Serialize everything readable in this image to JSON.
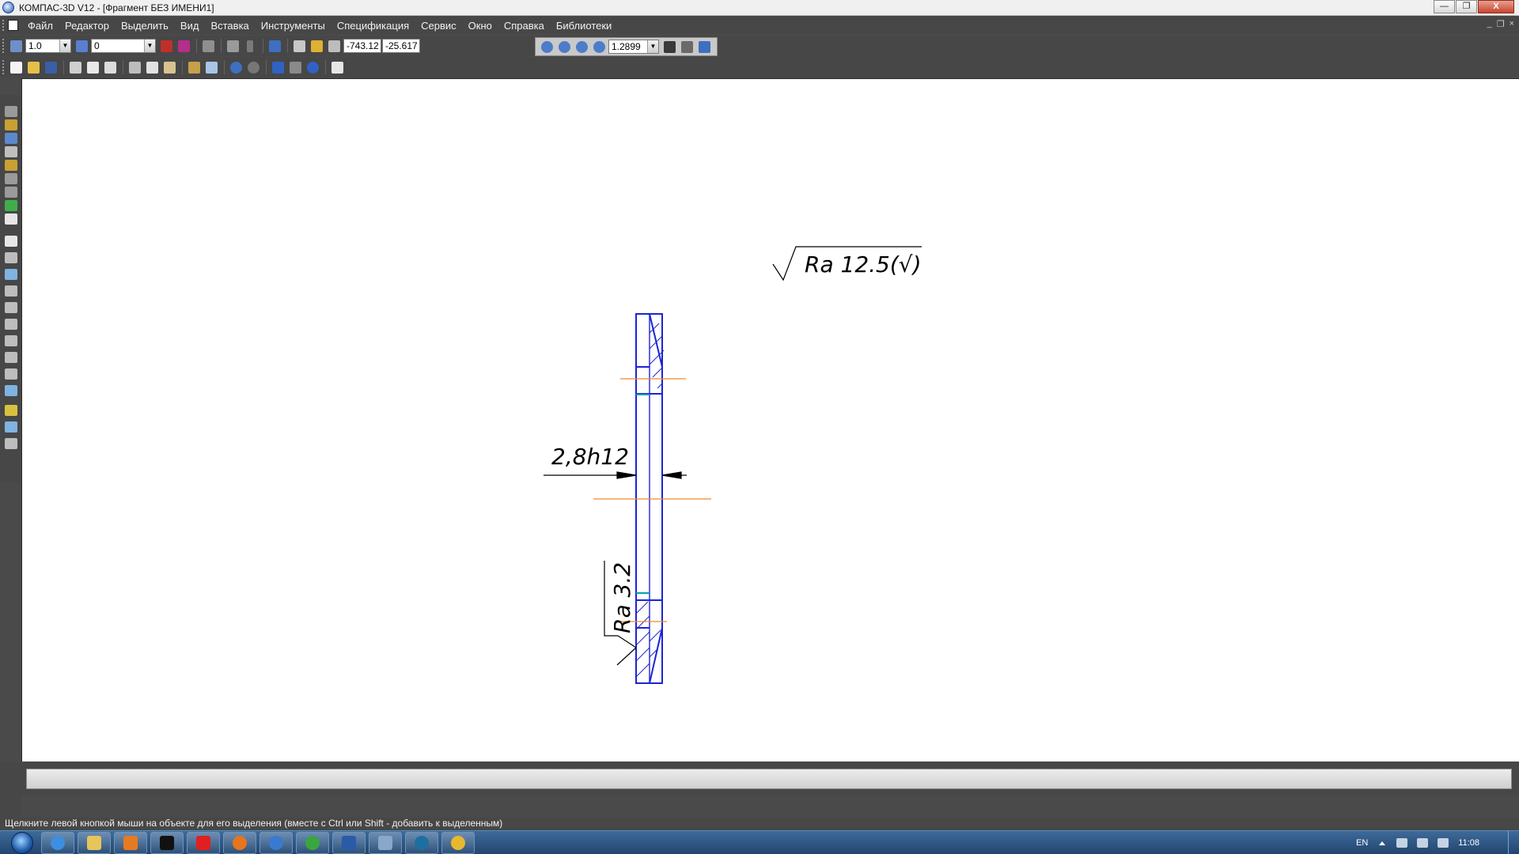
{
  "window": {
    "title": "КОМПАС-3D V12 - [Фрагмент БЕЗ ИМЕНИ1]",
    "controls": {
      "minimize": "—",
      "maximize": "❐",
      "close": "X"
    }
  },
  "menu": {
    "items": [
      "Файл",
      "Редактор",
      "Выделить",
      "Вид",
      "Вставка",
      "Инструменты",
      "Спецификация",
      "Сервис",
      "Окно",
      "Справка",
      "Библиотеки"
    ],
    "mdi_controls": [
      "_",
      "❐",
      "×"
    ]
  },
  "toolbar": {
    "step": "1.0",
    "layer": "0",
    "coord_x": "-743.12",
    "coord_y": "-25.617",
    "zoom": "1.2899"
  },
  "drawing": {
    "roughness_top": "Ra 12.5(√)",
    "roughness_side": "Ra 3.2",
    "dimension": "2,8h12"
  },
  "status_text": "Щелкните левой кнопкой мыши на объекте для его выделения (вместе с Ctrl или Shift - добавить к выделенным)",
  "taskbar": {
    "apps": [
      "ie-icon",
      "explorer-icon",
      "media-player-icon",
      "app-icon",
      "yandex-icon",
      "firefox-icon",
      "kompas-icon",
      "green-app-icon",
      "word-icon",
      "screen-icon",
      "browser-icon",
      "colored-app-icon"
    ],
    "language": "EN",
    "time": "11:08"
  },
  "colors": {
    "chrome": "#474747",
    "contour": "#1c24d6",
    "hidden": "#00a0b4",
    "axis": "#f08a2a",
    "annotation": "#000000"
  }
}
